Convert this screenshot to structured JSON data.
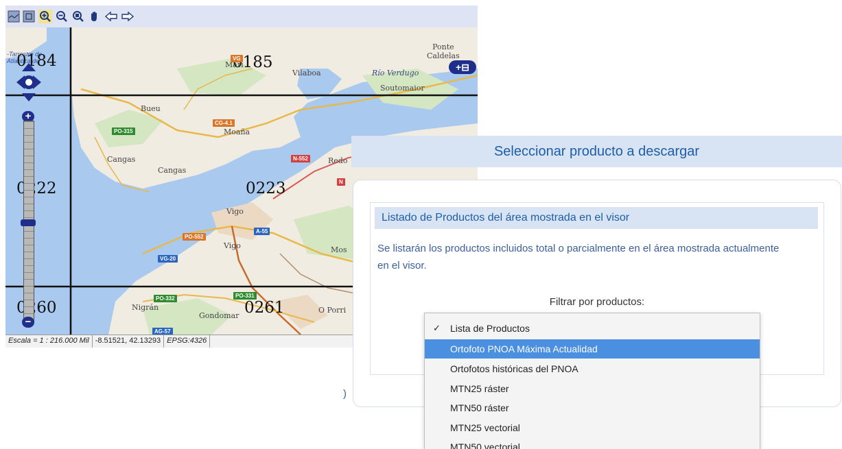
{
  "toolbar": {
    "buttons": [
      {
        "name": "overview-map-icon",
        "glyph": "〰"
      },
      {
        "name": "full-extent-icon",
        "glyph": "⛶"
      },
      {
        "name": "zoom-in-icon",
        "glyph": "+"
      },
      {
        "name": "zoom-out-icon",
        "glyph": "−"
      },
      {
        "name": "zoom-box-icon",
        "glyph": "○"
      },
      {
        "name": "pan-hand-icon",
        "glyph": "✋"
      },
      {
        "name": "back-arrow-icon",
        "glyph": "⇦"
      },
      {
        "name": "forward-arrow-icon",
        "glyph": "⇨"
      }
    ]
  },
  "map": {
    "attribution": "-Tarrestre de\nAtlantica de",
    "grid_labels": [
      "0184",
      "0185",
      "0222",
      "0223",
      "0260",
      "0261"
    ],
    "places": {
      "ponte_caldelas": "Ponte\nCaldelas",
      "vilaboa": "Vilaboa",
      "rio_verdugo": "Río Verdugo",
      "soutomaior": "Soutomaior",
      "bueu": "Bueu",
      "moana": "Moaña",
      "cangas_small": "Cangas",
      "cangas": "Cangas",
      "redondela": "Redo",
      "vigo_top": "Vigo",
      "vigo": "Vigo",
      "mos": "Mos",
      "nigran": "Nigrán",
      "gondomar": "Gondomar",
      "o_porrino": "O Porri",
      "marin": "Mari"
    },
    "roads": {
      "vg": "VG",
      "po315": "PO-315",
      "cg41": "CG-4.1",
      "n552": "N-552",
      "n550": "N",
      "a55": "A-55",
      "po552": "PO-552",
      "vg20": "VG-20",
      "po332": "PO-332",
      "po331": "PO-331",
      "ag57": "AG-57"
    },
    "zoom_in": "+",
    "zoom_out": "−",
    "layer_button": "+⊟"
  },
  "status": {
    "scale": "Escala = 1 : 216.000 Mil",
    "coords": "-8.51521, 42.13293",
    "epsg": "EPSG:4326"
  },
  "panel": {
    "title": "Seleccionar producto a descargar",
    "list_title": "Listado de Productos del área mostrada en el visor",
    "description": "Se listarán los productos incluidos total o parcialmente en el área mostrada actualmente en el visor.",
    "filter_label": "Filtrar por productos:",
    "side_arrow": ")"
  },
  "dropdown": {
    "checkmark": "✓",
    "options": [
      "Lista de Productos",
      "Ortofoto PNOA Máxima Actualidad",
      "Ortofotos históricas del PNOA",
      "MTN25 ráster",
      "MTN50 ráster",
      "MTN25 vectorial",
      "MTN50 vectorial"
    ]
  }
}
